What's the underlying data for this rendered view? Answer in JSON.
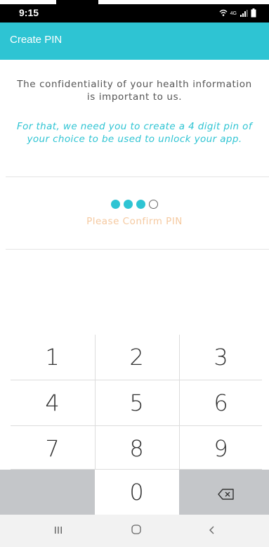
{
  "status_bar": {
    "time": "9:15",
    "network_label": "4G",
    "icons": [
      "wifi-calling-icon",
      "signal-icon",
      "battery-icon"
    ]
  },
  "app_bar": {
    "title": "Create PIN"
  },
  "info": {
    "line1": "The confidentiality of your health information is important to us.",
    "line2": "For that, we need you to create a 4 digit pin of your choice to be used to unlock your app."
  },
  "pin": {
    "digits_total": 4,
    "digits_entered": 3,
    "status": "Please Confirm PIN"
  },
  "keypad": {
    "keys": [
      "1",
      "2",
      "3",
      "4",
      "5",
      "6",
      "7",
      "8",
      "9",
      "",
      "0",
      "backspace"
    ]
  },
  "colors": {
    "accent": "#2ec4d3",
    "status_text": "#f5c9a0",
    "key_gray": "#c4c6c9"
  },
  "nav_bar": {
    "buttons": [
      "recent-apps-icon",
      "home-icon",
      "back-icon"
    ]
  }
}
